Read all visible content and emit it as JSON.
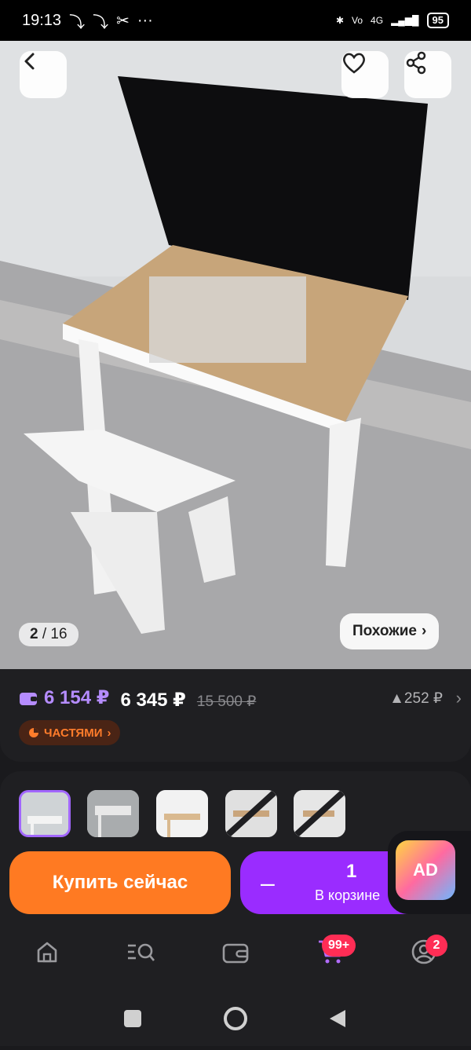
{
  "status": {
    "time": "19:13",
    "battery": "95",
    "network": "4G"
  },
  "hero": {
    "counter_current": "2",
    "counter_total": "/ 16",
    "similar_label": "Похожие"
  },
  "price": {
    "wallet_price": "6 154 ₽",
    "price": "6 345 ₽",
    "old_price": "15 500 ₽",
    "rating": "▲252 ₽",
    "installments": "ЧАСТЯМИ"
  },
  "actions": {
    "buy_label": "Купить сейчас",
    "cart_qty": "1",
    "cart_label": "В корзине",
    "ad_label": "AD"
  },
  "tabs": {
    "cart_badge": "99+",
    "profile_badge": "2"
  },
  "colors": {
    "accent": "#9a2cff",
    "buy": "#ff7a22",
    "badge": "#ff2d55"
  }
}
